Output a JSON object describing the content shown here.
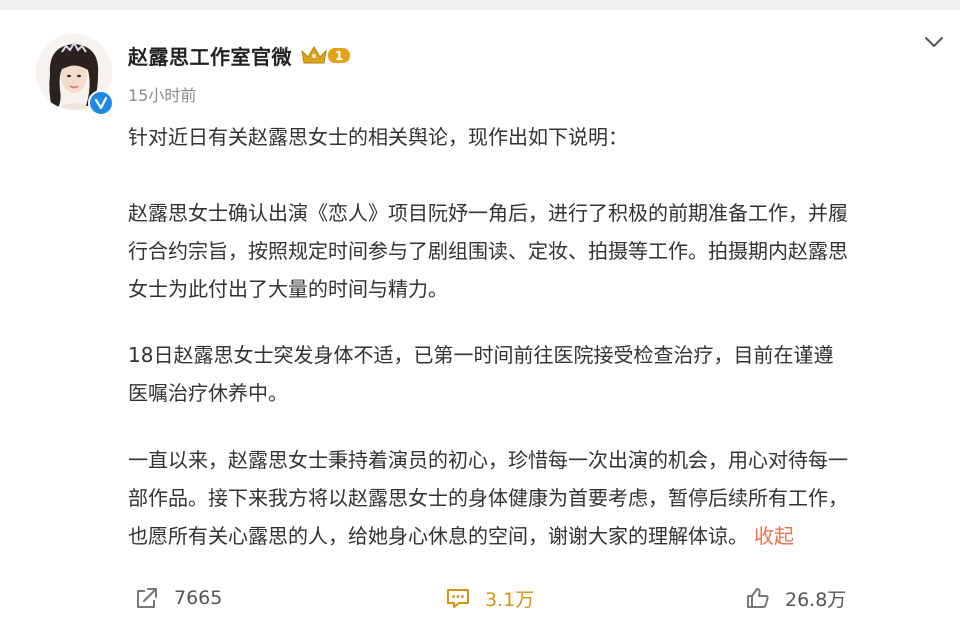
{
  "post": {
    "author": "赵露思工作室官微",
    "vip_level": "1",
    "time": "15小时前",
    "paragraphs": {
      "p1": "针对近日有关赵露思女士的相关舆论，现作出如下说明：",
      "p2_l1": "赵露思女士确认出演《恋人》项目阮妤一角后，进行了积极的前期准备工作，并履",
      "p2_l2": "行合约宗旨，按照规定时间参与了剧组围读、定妆、拍摄等工作。拍摄期内赵露思",
      "p2_l3": "女士为此付出了大量的时间与精力。",
      "p3_l1": "18日赵露思女士突发身体不适，已第一时间前往医院接受检查治疗，目前在谨遵",
      "p3_l2": "医嘱治疗休养中。",
      "p4_l1": "一直以来，赵露思女士秉持着演员的初心，珍惜每一次出演的机会，用心对待每一",
      "p4_l2": "部作品。接下来我方将以赵露思女士的身体健康为首要考虑，暂停后续所有工作，",
      "p4_l3": "也愿所有关心露思的人，给她身心休息的空间，谢谢大家的理解体谅。"
    },
    "collapse_label": "收起"
  },
  "actions": {
    "share_count": "7665",
    "comment_count": "3.1万",
    "like_count": "26.8万"
  },
  "colors": {
    "accent_orange": "#eb7350",
    "comment_gold": "#d4940e",
    "verified_blue": "#1e88e5"
  },
  "icons": [
    "avatar",
    "verified-icon",
    "vip-crown-icon",
    "chevron-down-icon",
    "share-icon",
    "comment-icon",
    "like-icon"
  ]
}
